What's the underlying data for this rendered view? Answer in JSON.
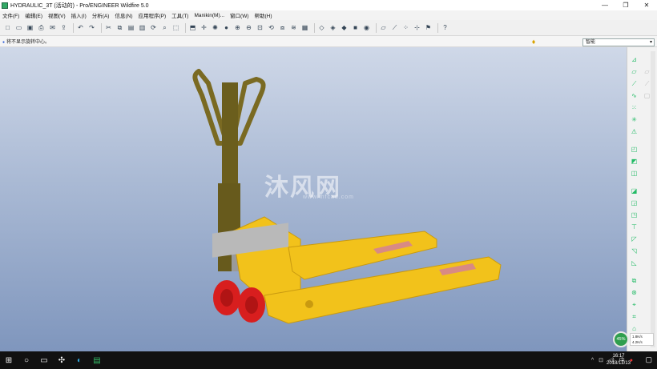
{
  "window": {
    "title": "HYDRAULIC_3T (活动的) - Pro/ENGINEER Wildfire 5.0",
    "min": "—",
    "max": "❐",
    "close": "✕"
  },
  "menu": [
    "文件(F)",
    "编辑(E)",
    "视图(V)",
    "插入(I)",
    "分析(A)",
    "信息(N)",
    "应用程序(P)",
    "工具(T)",
    "Manikin(M)...",
    "窗口(W)",
    "帮助(H)"
  ],
  "status": {
    "message": "将不显示旋转中心。",
    "filter_value": "智能"
  },
  "watermark": {
    "text": "沐风网",
    "sub": "www.mfcad.com"
  },
  "gauge": {
    "percent": "45%",
    "up": "1.8K/s",
    "down": "4.2K/s"
  },
  "taskbar": {
    "time": "16:17",
    "date": "2018/12/13",
    "ime": "中"
  },
  "colors": {
    "fork_yellow": "#f2c21b",
    "wheel_red": "#d81e1e",
    "handle_olive": "#7a6a22",
    "pad_pink": "#d88a84"
  }
}
